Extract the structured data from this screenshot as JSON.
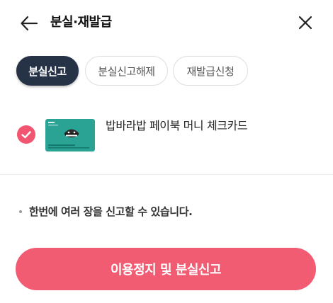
{
  "header": {
    "title": "분실·재발급",
    "back_icon": "arrow-left-icon",
    "close_icon": "close-icon"
  },
  "tabs": [
    {
      "label": "분실신고",
      "active": true
    },
    {
      "label": "분실신고해제",
      "active": false
    },
    {
      "label": "재발급신청",
      "active": false
    }
  ],
  "card": {
    "name": "밥바라밥 페이북 머니 체크카드",
    "selected": true,
    "check_icon": "checkmark-icon"
  },
  "notice": {
    "text": "한번에 여러 장을 신고할 수 있습니다."
  },
  "cta": {
    "label": "이용정지 및 분실신고"
  },
  "colors": {
    "accent_pink": "#f25c73",
    "active_tab_navy": "#263347",
    "card_teal": "#2aa394"
  }
}
